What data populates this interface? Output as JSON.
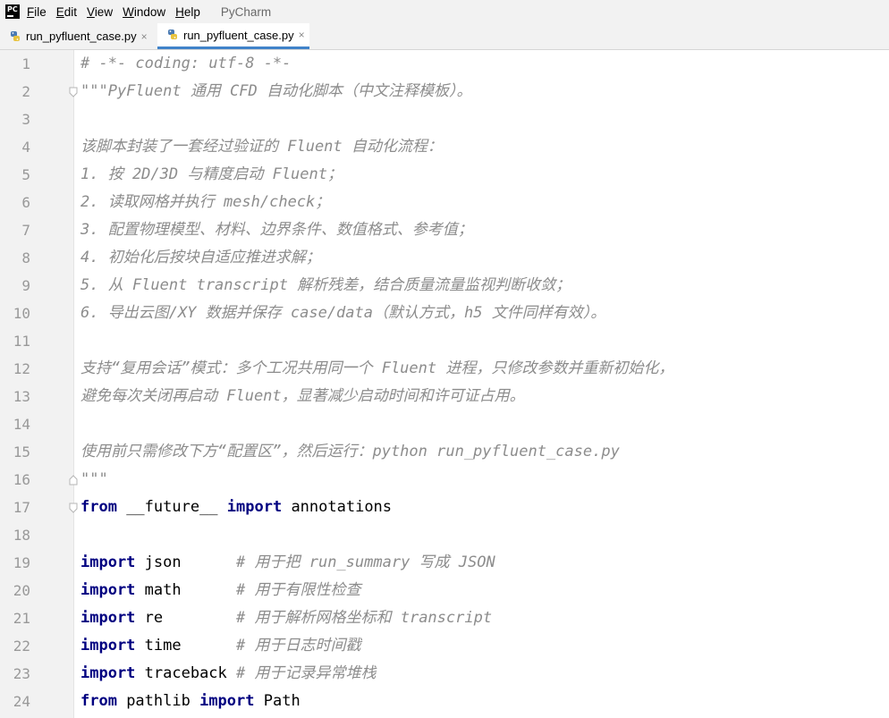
{
  "menubar": {
    "logo_text": "PC",
    "items": [
      {
        "mnemonic": "F",
        "rest": "ile"
      },
      {
        "mnemonic": "E",
        "rest": "dit"
      },
      {
        "mnemonic": "V",
        "rest": "iew"
      },
      {
        "mnemonic": "W",
        "rest": "indow"
      },
      {
        "mnemonic": "H",
        "rest": "elp"
      }
    ],
    "app_title": "PyCharm"
  },
  "tabs": [
    {
      "label": "run_pyfluent_case.py",
      "close": "×",
      "active": false
    },
    {
      "label": "run_pyfluent_case.py",
      "close": "×",
      "active": true
    }
  ],
  "editor": {
    "lines": [
      {
        "n": "1",
        "segs": [
          {
            "t": "# -*- coding: utf-8 -*-",
            "c": "cm"
          }
        ]
      },
      {
        "n": "2",
        "segs": [
          {
            "t": "\"\"\"PyFluent 通用 CFD 自动化脚本（中文注释模板）。",
            "c": "cm"
          }
        ]
      },
      {
        "n": "3",
        "segs": []
      },
      {
        "n": "4",
        "segs": [
          {
            "t": "该脚本封装了一套经过验证的 Fluent 自动化流程：",
            "c": "cm"
          }
        ]
      },
      {
        "n": "5",
        "segs": [
          {
            "t": "1. 按 2D/3D 与精度启动 Fluent；",
            "c": "cm"
          }
        ]
      },
      {
        "n": "6",
        "segs": [
          {
            "t": "2. 读取网格并执行 mesh/check；",
            "c": "cm"
          }
        ]
      },
      {
        "n": "7",
        "segs": [
          {
            "t": "3. 配置物理模型、材料、边界条件、数值格式、参考值；",
            "c": "cm"
          }
        ]
      },
      {
        "n": "8",
        "segs": [
          {
            "t": "4. 初始化后按块自适应推进求解；",
            "c": "cm"
          }
        ]
      },
      {
        "n": "9",
        "segs": [
          {
            "t": "5. 从 Fluent transcript 解析残差，结合质量流量监视判断收敛；",
            "c": "cm"
          }
        ]
      },
      {
        "n": "10",
        "segs": [
          {
            "t": "6. 导出云图/XY 数据并保存 case/data（默认方式，h5 文件同样有效）。",
            "c": "cm"
          }
        ]
      },
      {
        "n": "11",
        "segs": []
      },
      {
        "n": "12",
        "segs": [
          {
            "t": "支持“复用会话”模式：多个工况共用同一个 Fluent 进程，只修改参数并重新初始化，",
            "c": "cm"
          }
        ]
      },
      {
        "n": "13",
        "segs": [
          {
            "t": "避免每次关闭再启动 Fluent，显著减少启动时间和许可证占用。",
            "c": "cm"
          }
        ]
      },
      {
        "n": "14",
        "segs": []
      },
      {
        "n": "15",
        "segs": [
          {
            "t": "使用前只需修改下方“配置区”，然后运行：python run_pyfluent_case.py",
            "c": "cm"
          }
        ]
      },
      {
        "n": "16",
        "segs": [
          {
            "t": "\"\"\"",
            "c": "cm"
          }
        ]
      },
      {
        "n": "17",
        "segs": [
          {
            "t": "from",
            "c": "kw"
          },
          {
            "t": " __future__ ",
            "c": "id"
          },
          {
            "t": "import",
            "c": "kw"
          },
          {
            "t": " annotations",
            "c": "id"
          }
        ]
      },
      {
        "n": "18",
        "segs": []
      },
      {
        "n": "19",
        "segs": [
          {
            "t": "import",
            "c": "kw"
          },
          {
            "t": " json      ",
            "c": "id"
          },
          {
            "t": "# 用于把 run_summary 写成 JSON",
            "c": "cm"
          }
        ]
      },
      {
        "n": "20",
        "segs": [
          {
            "t": "import",
            "c": "kw"
          },
          {
            "t": " math      ",
            "c": "id"
          },
          {
            "t": "# 用于有限性检查",
            "c": "cm"
          }
        ]
      },
      {
        "n": "21",
        "segs": [
          {
            "t": "import",
            "c": "kw"
          },
          {
            "t": " re        ",
            "c": "id"
          },
          {
            "t": "# 用于解析网格坐标和 transcript",
            "c": "cm"
          }
        ]
      },
      {
        "n": "22",
        "segs": [
          {
            "t": "import",
            "c": "kw"
          },
          {
            "t": " time      ",
            "c": "id"
          },
          {
            "t": "# 用于日志时间戳",
            "c": "cm"
          }
        ]
      },
      {
        "n": "23",
        "segs": [
          {
            "t": "import",
            "c": "kw"
          },
          {
            "t": " traceback ",
            "c": "id"
          },
          {
            "t": "# 用于记录异常堆栈",
            "c": "cm"
          }
        ]
      },
      {
        "n": "24",
        "segs": [
          {
            "t": "from",
            "c": "kw"
          },
          {
            "t": " pathlib ",
            "c": "id"
          },
          {
            "t": "import",
            "c": "kw"
          },
          {
            "t": " Path",
            "c": "id"
          }
        ]
      }
    ]
  }
}
